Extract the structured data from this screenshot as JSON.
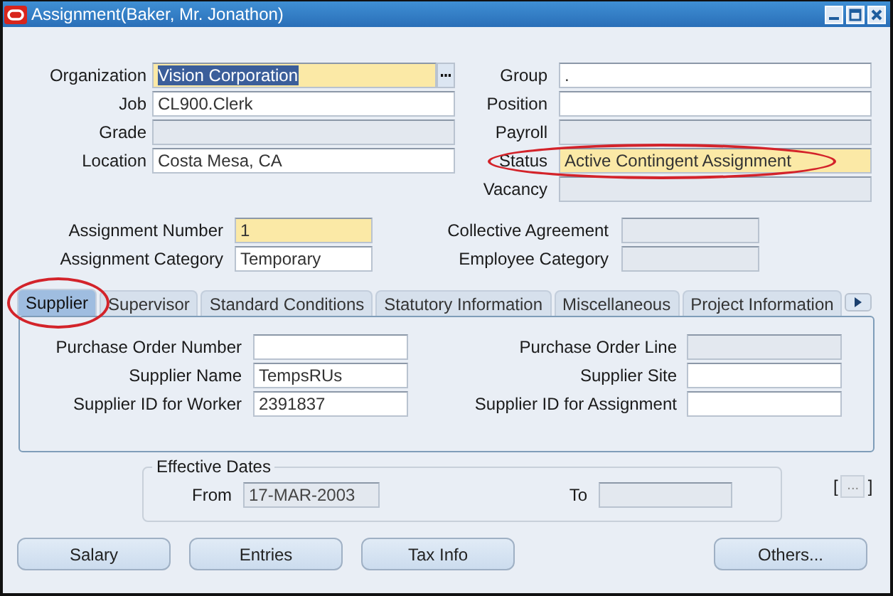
{
  "window": {
    "title": "Assignment(Baker, Mr. Jonathon)"
  },
  "main_left": [
    {
      "label": "Organization",
      "value": "Vision Corporation",
      "kind": "required",
      "text_selected": true,
      "list_button": true
    },
    {
      "label": "Job",
      "value": "CL900.Clerk",
      "kind": "normal"
    },
    {
      "label": "Grade",
      "kind": "disabled"
    },
    {
      "label": "Location",
      "value": "Costa Mesa, CA",
      "kind": "normal"
    }
  ],
  "main_right": [
    {
      "label": "Group",
      "value": ".",
      "kind": "normal"
    },
    {
      "label": "Position",
      "kind": "normal"
    },
    {
      "label": "Payroll",
      "kind": "disabled"
    },
    {
      "label": "Status",
      "value": "Active Contingent Assignment",
      "kind": "required",
      "circled": true
    },
    {
      "label": "Vacancy",
      "kind": "disabled"
    }
  ],
  "assignment_left": [
    {
      "label": "Assignment Number",
      "value": "1",
      "kind": "required"
    },
    {
      "label": "Assignment Category",
      "value": "Temporary",
      "kind": "normal"
    }
  ],
  "assignment_right": [
    {
      "label": "Collective Agreement",
      "kind": "disabled"
    },
    {
      "label": "Employee Category",
      "kind": "disabled"
    }
  ],
  "tabs": [
    {
      "label": "Supplier",
      "selected": true,
      "circled": true
    },
    {
      "label": "Supervisor",
      "selected": false
    },
    {
      "label": "Standard Conditions",
      "selected": false
    },
    {
      "label": "Statutory Information",
      "selected": false
    },
    {
      "label": "Miscellaneous",
      "selected": false
    },
    {
      "label": "Project Information",
      "selected": false
    }
  ],
  "supplier_left": [
    {
      "label": "Purchase Order Number",
      "kind": "normal"
    },
    {
      "label": "Supplier Name",
      "value": "TempsRUs",
      "kind": "normal"
    },
    {
      "label": "Supplier ID for Worker",
      "value": "2391837",
      "kind": "normal"
    }
  ],
  "supplier_right": [
    {
      "label": "Purchase Order Line",
      "kind": "disabled"
    },
    {
      "label": "Supplier Site",
      "kind": "normal"
    },
    {
      "label": "Supplier ID for Assignment",
      "kind": "normal"
    }
  ],
  "effective_dates": {
    "legend": "Effective Dates",
    "from_label": "From",
    "from_value": "17-MAR-2003",
    "from_disabled": true,
    "to_label": "To",
    "to_disabled": true
  },
  "flexfield": {
    "open": "[",
    "button": "...",
    "close": "]"
  },
  "buttons": [
    {
      "label": "Salary"
    },
    {
      "label": "Entries"
    },
    {
      "label": "Tax Info"
    },
    {
      "label": "Others..."
    }
  ]
}
